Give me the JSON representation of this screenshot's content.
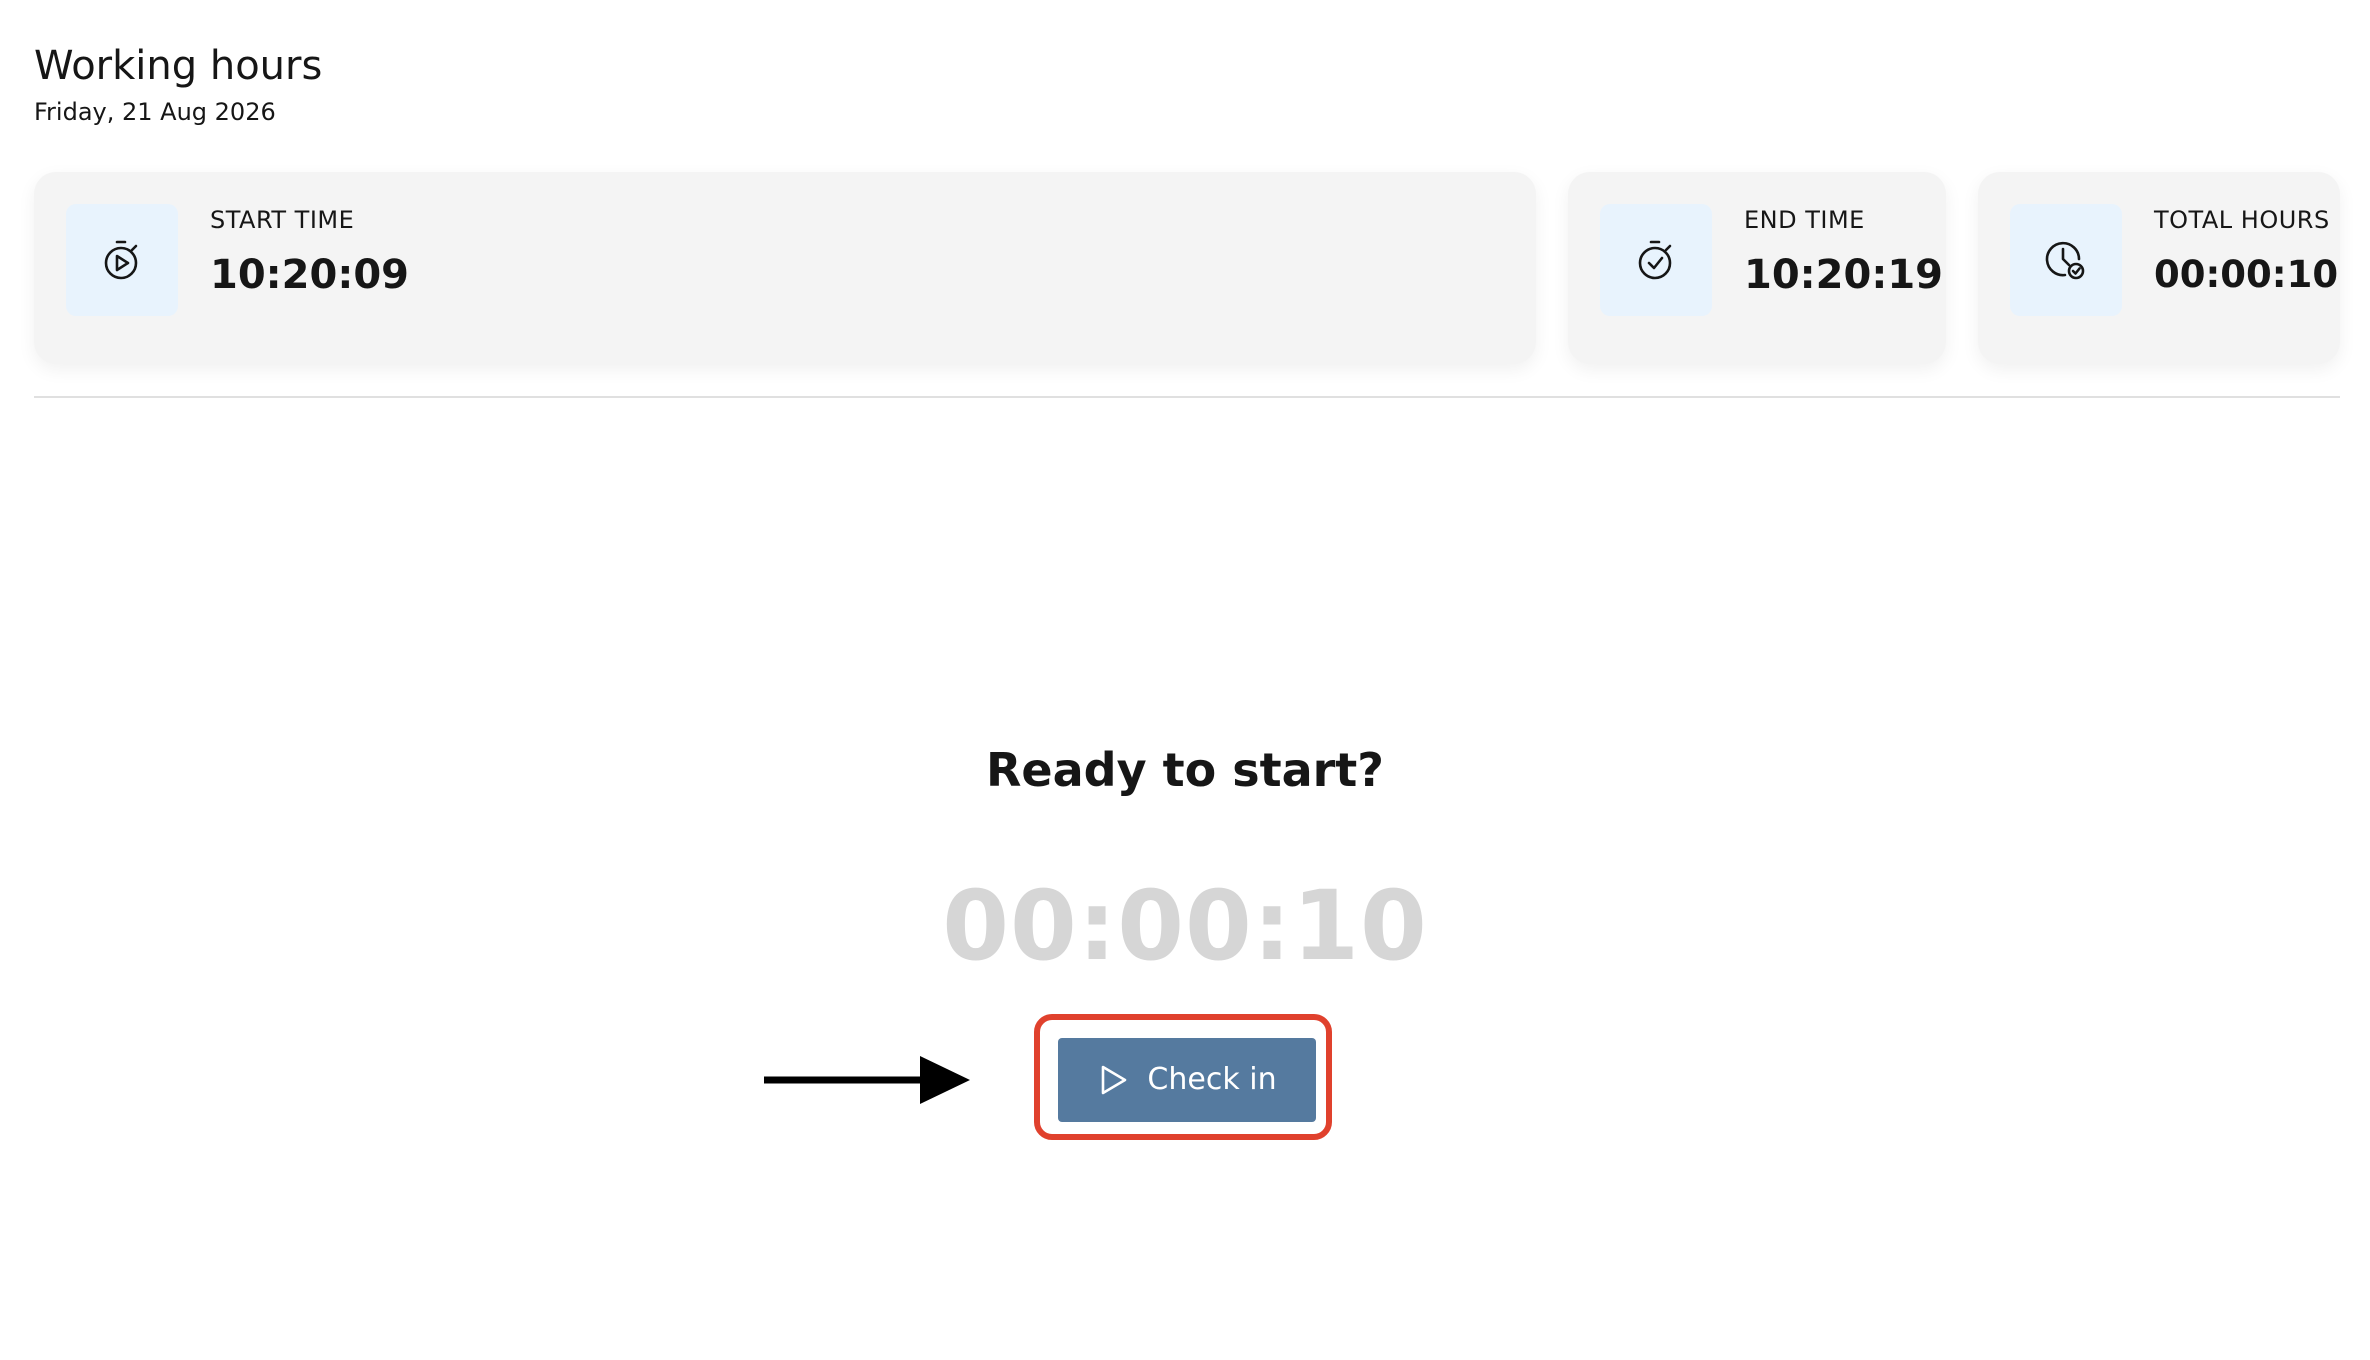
{
  "header": {
    "title": "Working hours",
    "date": "Friday, 21 Aug 2026"
  },
  "cards": {
    "start": {
      "label": "START TIME",
      "value": "10:20:09",
      "icon": "stopwatch-play-icon"
    },
    "end": {
      "label": "END TIME",
      "value": "10:20:19",
      "icon": "stopwatch-check-icon"
    },
    "total": {
      "label": "TOTAL HOURS",
      "value": "00:00:10",
      "icon": "clock-check-icon"
    }
  },
  "main": {
    "prompt": "Ready to start?",
    "timer": "00:00:10",
    "check_in_label": "Check in",
    "check_in_icon": "play-icon"
  },
  "colors": {
    "icon_box_bg": "#e8f3fd",
    "button_bg": "#557a9f",
    "highlight": "#e0412d",
    "timer_text": "#d6d6d6"
  }
}
